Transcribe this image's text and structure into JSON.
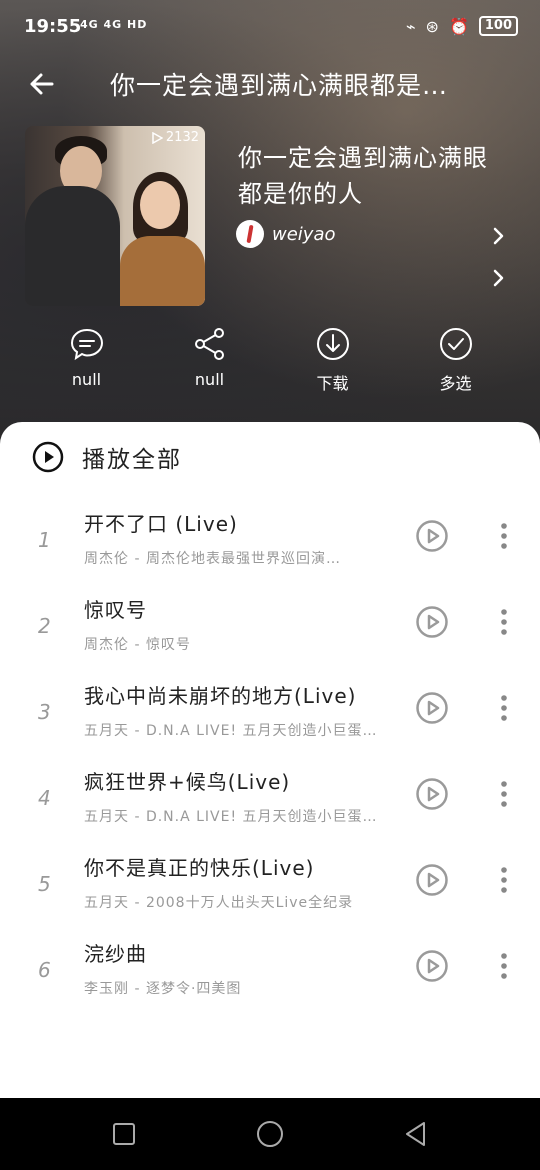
{
  "status_bar": {
    "time": "19:55",
    "network": "4G 4G HD",
    "battery": "100"
  },
  "header": {
    "title": "你一定会遇到满心满眼都是…"
  },
  "playlist": {
    "cover_play_count": "2132",
    "name": "你一定会遇到满心满眼都是你的人",
    "creator": "weiyao"
  },
  "actions": [
    {
      "label": "null",
      "icon": "comment-icon"
    },
    {
      "label": "null",
      "icon": "share-icon"
    },
    {
      "label": "下载",
      "icon": "download-icon"
    },
    {
      "label": "多选",
      "icon": "multi-select-icon"
    }
  ],
  "play_all": {
    "label": "播放全部"
  },
  "songs": [
    {
      "index": "1",
      "title": "开不了口 (Live)",
      "subtitle": "周杰伦 - 周杰伦地表最强世界巡回演…"
    },
    {
      "index": "2",
      "title": "惊叹号",
      "subtitle": "周杰伦 - 惊叹号"
    },
    {
      "index": "3",
      "title": "我心中尚未崩坏的地方(Live)",
      "subtitle": "五月天 - D.N.A LIVE! 五月天创造小巨蛋…"
    },
    {
      "index": "4",
      "title": "疯狂世界+候鸟(Live)",
      "subtitle": "五月天 - D.N.A LIVE! 五月天创造小巨蛋…"
    },
    {
      "index": "5",
      "title": "你不是真正的快乐(Live)",
      "subtitle": "五月天 - 2008十万人出头天Live全纪录"
    },
    {
      "index": "6",
      "title": "浣纱曲",
      "subtitle": "李玉刚 - 逐梦令·四美图"
    }
  ],
  "colors": {
    "accent": "#222222",
    "secondary_text": "#999999",
    "icon_gray": "#9a9a9a"
  }
}
